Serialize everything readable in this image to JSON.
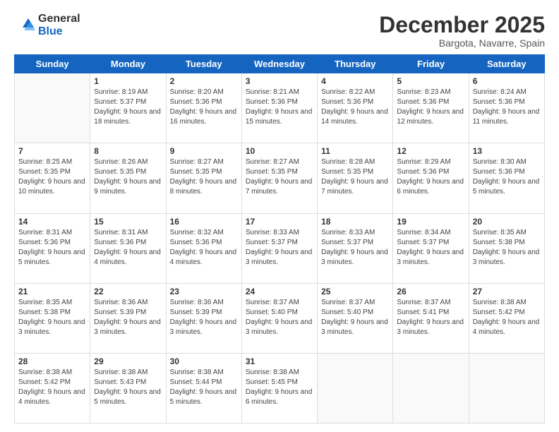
{
  "logo": {
    "general": "General",
    "blue": "Blue"
  },
  "header": {
    "month": "December 2025",
    "location": "Bargota, Navarre, Spain"
  },
  "weekdays": [
    "Sunday",
    "Monday",
    "Tuesday",
    "Wednesday",
    "Thursday",
    "Friday",
    "Saturday"
  ],
  "weeks": [
    [
      {
        "day": "",
        "sunrise": "",
        "sunset": "",
        "daylight": ""
      },
      {
        "day": "1",
        "sunrise": "Sunrise: 8:19 AM",
        "sunset": "Sunset: 5:37 PM",
        "daylight": "Daylight: 9 hours and 18 minutes."
      },
      {
        "day": "2",
        "sunrise": "Sunrise: 8:20 AM",
        "sunset": "Sunset: 5:36 PM",
        "daylight": "Daylight: 9 hours and 16 minutes."
      },
      {
        "day": "3",
        "sunrise": "Sunrise: 8:21 AM",
        "sunset": "Sunset: 5:36 PM",
        "daylight": "Daylight: 9 hours and 15 minutes."
      },
      {
        "day": "4",
        "sunrise": "Sunrise: 8:22 AM",
        "sunset": "Sunset: 5:36 PM",
        "daylight": "Daylight: 9 hours and 14 minutes."
      },
      {
        "day": "5",
        "sunrise": "Sunrise: 8:23 AM",
        "sunset": "Sunset: 5:36 PM",
        "daylight": "Daylight: 9 hours and 12 minutes."
      },
      {
        "day": "6",
        "sunrise": "Sunrise: 8:24 AM",
        "sunset": "Sunset: 5:36 PM",
        "daylight": "Daylight: 9 hours and 11 minutes."
      }
    ],
    [
      {
        "day": "7",
        "sunrise": "Sunrise: 8:25 AM",
        "sunset": "Sunset: 5:35 PM",
        "daylight": "Daylight: 9 hours and 10 minutes."
      },
      {
        "day": "8",
        "sunrise": "Sunrise: 8:26 AM",
        "sunset": "Sunset: 5:35 PM",
        "daylight": "Daylight: 9 hours and 9 minutes."
      },
      {
        "day": "9",
        "sunrise": "Sunrise: 8:27 AM",
        "sunset": "Sunset: 5:35 PM",
        "daylight": "Daylight: 9 hours and 8 minutes."
      },
      {
        "day": "10",
        "sunrise": "Sunrise: 8:27 AM",
        "sunset": "Sunset: 5:35 PM",
        "daylight": "Daylight: 9 hours and 7 minutes."
      },
      {
        "day": "11",
        "sunrise": "Sunrise: 8:28 AM",
        "sunset": "Sunset: 5:35 PM",
        "daylight": "Daylight: 9 hours and 7 minutes."
      },
      {
        "day": "12",
        "sunrise": "Sunrise: 8:29 AM",
        "sunset": "Sunset: 5:36 PM",
        "daylight": "Daylight: 9 hours and 6 minutes."
      },
      {
        "day": "13",
        "sunrise": "Sunrise: 8:30 AM",
        "sunset": "Sunset: 5:36 PM",
        "daylight": "Daylight: 9 hours and 5 minutes."
      }
    ],
    [
      {
        "day": "14",
        "sunrise": "Sunrise: 8:31 AM",
        "sunset": "Sunset: 5:36 PM",
        "daylight": "Daylight: 9 hours and 5 minutes."
      },
      {
        "day": "15",
        "sunrise": "Sunrise: 8:31 AM",
        "sunset": "Sunset: 5:36 PM",
        "daylight": "Daylight: 9 hours and 4 minutes."
      },
      {
        "day": "16",
        "sunrise": "Sunrise: 8:32 AM",
        "sunset": "Sunset: 5:36 PM",
        "daylight": "Daylight: 9 hours and 4 minutes."
      },
      {
        "day": "17",
        "sunrise": "Sunrise: 8:33 AM",
        "sunset": "Sunset: 5:37 PM",
        "daylight": "Daylight: 9 hours and 3 minutes."
      },
      {
        "day": "18",
        "sunrise": "Sunrise: 8:33 AM",
        "sunset": "Sunset: 5:37 PM",
        "daylight": "Daylight: 9 hours and 3 minutes."
      },
      {
        "day": "19",
        "sunrise": "Sunrise: 8:34 AM",
        "sunset": "Sunset: 5:37 PM",
        "daylight": "Daylight: 9 hours and 3 minutes."
      },
      {
        "day": "20",
        "sunrise": "Sunrise: 8:35 AM",
        "sunset": "Sunset: 5:38 PM",
        "daylight": "Daylight: 9 hours and 3 minutes."
      }
    ],
    [
      {
        "day": "21",
        "sunrise": "Sunrise: 8:35 AM",
        "sunset": "Sunset: 5:38 PM",
        "daylight": "Daylight: 9 hours and 3 minutes."
      },
      {
        "day": "22",
        "sunrise": "Sunrise: 8:36 AM",
        "sunset": "Sunset: 5:39 PM",
        "daylight": "Daylight: 9 hours and 3 minutes."
      },
      {
        "day": "23",
        "sunrise": "Sunrise: 8:36 AM",
        "sunset": "Sunset: 5:39 PM",
        "daylight": "Daylight: 9 hours and 3 minutes."
      },
      {
        "day": "24",
        "sunrise": "Sunrise: 8:37 AM",
        "sunset": "Sunset: 5:40 PM",
        "daylight": "Daylight: 9 hours and 3 minutes."
      },
      {
        "day": "25",
        "sunrise": "Sunrise: 8:37 AM",
        "sunset": "Sunset: 5:40 PM",
        "daylight": "Daylight: 9 hours and 3 minutes."
      },
      {
        "day": "26",
        "sunrise": "Sunrise: 8:37 AM",
        "sunset": "Sunset: 5:41 PM",
        "daylight": "Daylight: 9 hours and 3 minutes."
      },
      {
        "day": "27",
        "sunrise": "Sunrise: 8:38 AM",
        "sunset": "Sunset: 5:42 PM",
        "daylight": "Daylight: 9 hours and 4 minutes."
      }
    ],
    [
      {
        "day": "28",
        "sunrise": "Sunrise: 8:38 AM",
        "sunset": "Sunset: 5:42 PM",
        "daylight": "Daylight: 9 hours and 4 minutes."
      },
      {
        "day": "29",
        "sunrise": "Sunrise: 8:38 AM",
        "sunset": "Sunset: 5:43 PM",
        "daylight": "Daylight: 9 hours and 5 minutes."
      },
      {
        "day": "30",
        "sunrise": "Sunrise: 8:38 AM",
        "sunset": "Sunset: 5:44 PM",
        "daylight": "Daylight: 9 hours and 5 minutes."
      },
      {
        "day": "31",
        "sunrise": "Sunrise: 8:38 AM",
        "sunset": "Sunset: 5:45 PM",
        "daylight": "Daylight: 9 hours and 6 minutes."
      },
      {
        "day": "",
        "sunrise": "",
        "sunset": "",
        "daylight": ""
      },
      {
        "day": "",
        "sunrise": "",
        "sunset": "",
        "daylight": ""
      },
      {
        "day": "",
        "sunrise": "",
        "sunset": "",
        "daylight": ""
      }
    ]
  ]
}
